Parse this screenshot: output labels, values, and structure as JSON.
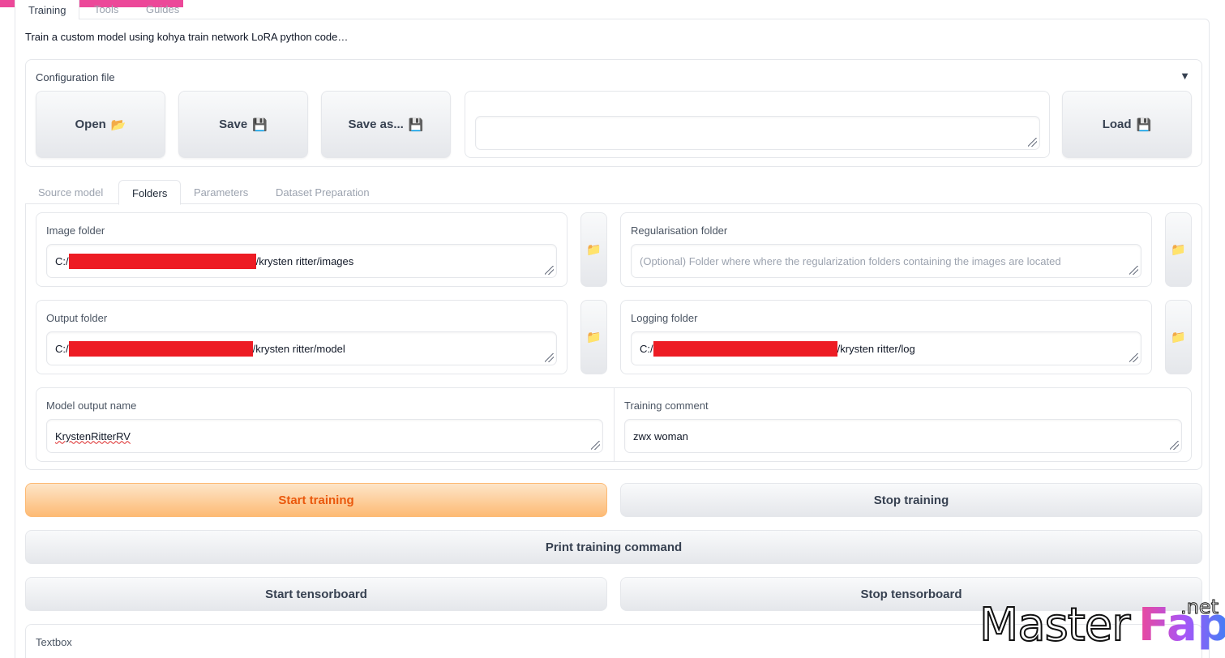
{
  "top_tabs": [
    "Training",
    "Tools",
    "Guides"
  ],
  "description": "Train a custom model using kohya train network LoRA python code…",
  "config": {
    "label": "Configuration file",
    "arrow": "▼",
    "open_label": "Open",
    "save_label": "Save",
    "save_as_label": "Save as...",
    "load_label": "Load",
    "folder_emoji": "📂",
    "disk_emoji": "💾",
    "path_value": ""
  },
  "sub_tabs": [
    "Source model",
    "Folders",
    "Parameters",
    "Dataset Preparation"
  ],
  "folders": {
    "image_folder": {
      "label": "Image folder",
      "prefix": "C:/",
      "suffix": "/krysten ritter/images"
    },
    "reg_folder": {
      "label": "Regularisation folder",
      "placeholder": "(Optional) Folder where where the regularization folders containing the images are located"
    },
    "output_folder": {
      "label": "Output folder",
      "prefix": "C:/",
      "suffix": "/krysten ritter/model"
    },
    "logging_folder": {
      "label": "Logging folder",
      "prefix": "C:/",
      "suffix": "/krysten ritter/log"
    },
    "model_output_name": {
      "label": "Model output name",
      "value": "KrystenRitterRV"
    },
    "training_comment": {
      "label": "Training comment",
      "value": "zwx woman"
    },
    "folder_icon": "📁"
  },
  "actions": {
    "start_training": "Start training",
    "stop_training": "Stop training",
    "print_command": "Print training command",
    "start_tensorboard": "Start tensorboard",
    "stop_tensorboard": "Stop tensorboard"
  },
  "textbox": {
    "label": "Textbox"
  },
  "watermark": {
    "master": "Master",
    "fap": "Fap",
    "net": ".net"
  },
  "colors": {
    "accent": "#fdba74",
    "accent_text": "#ea580c",
    "redaction": "#ed1c24",
    "brand_pink": "#ec4899"
  }
}
